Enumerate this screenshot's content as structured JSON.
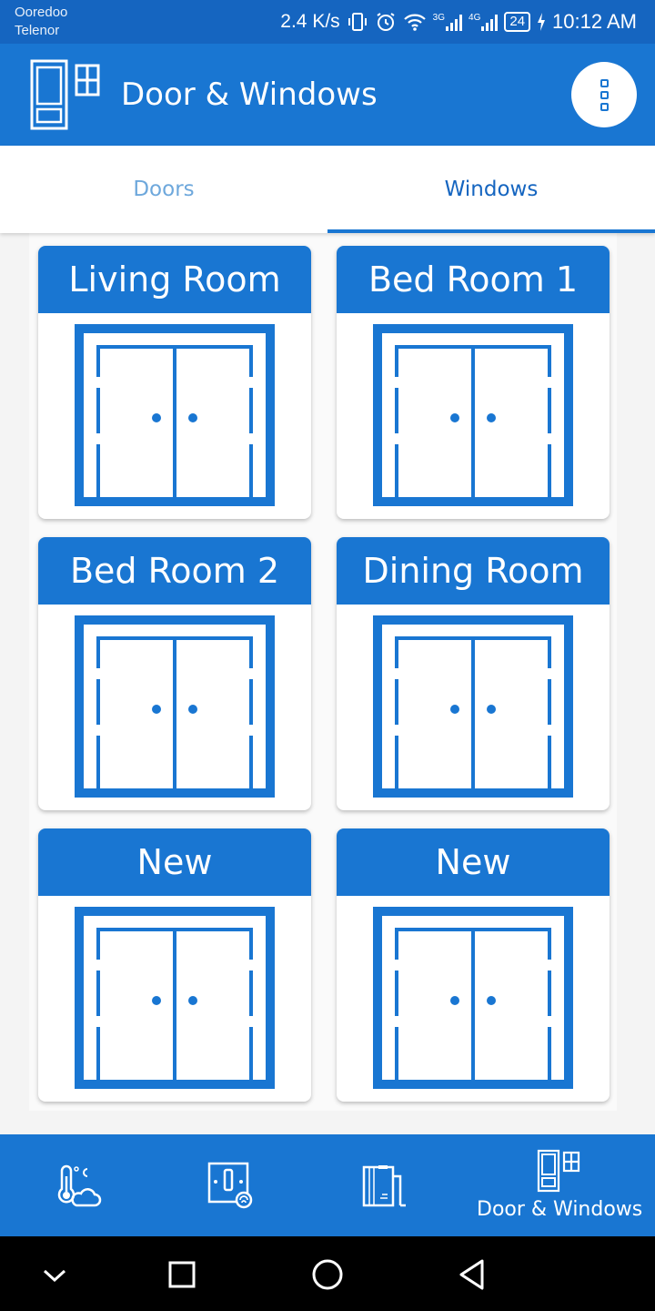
{
  "status_bar": {
    "carrier_1": "Ooredoo",
    "carrier_2": "Telenor",
    "speed": "2.4 K/s",
    "net_3g": "3G",
    "net_4g": "4G",
    "battery": "24",
    "time": "10:12 AM"
  },
  "app_bar": {
    "title": "Door & Windows",
    "menu_icon": "more-vert-icon"
  },
  "tabs": [
    {
      "label": "Doors",
      "selected": false
    },
    {
      "label": "Windows",
      "selected": true
    }
  ],
  "cards": [
    {
      "title": "Living Room",
      "icon": "window-icon"
    },
    {
      "title": "Bed Room 1",
      "icon": "window-icon"
    },
    {
      "title": "Bed Room 2",
      "icon": "window-icon"
    },
    {
      "title": "Dining Room",
      "icon": "window-icon"
    },
    {
      "title": "New",
      "icon": "window-icon"
    },
    {
      "title": "New",
      "icon": "window-icon"
    }
  ],
  "bottom_nav": {
    "items": [
      {
        "icon": "thermometer-cloud-icon"
      },
      {
        "icon": "switch-panel-icon"
      },
      {
        "icon": "appliance-icon"
      },
      {
        "icon": "door-window-icon",
        "label": "Door & Windows",
        "active": true
      }
    ]
  },
  "system_nav": [
    "back-chevron-icon",
    "recents-icon",
    "home-icon",
    "back-icon"
  ],
  "colors": {
    "primary": "#1976d2",
    "primary_dark": "#1565c0",
    "tab_inactive": "#6ea8dc"
  }
}
